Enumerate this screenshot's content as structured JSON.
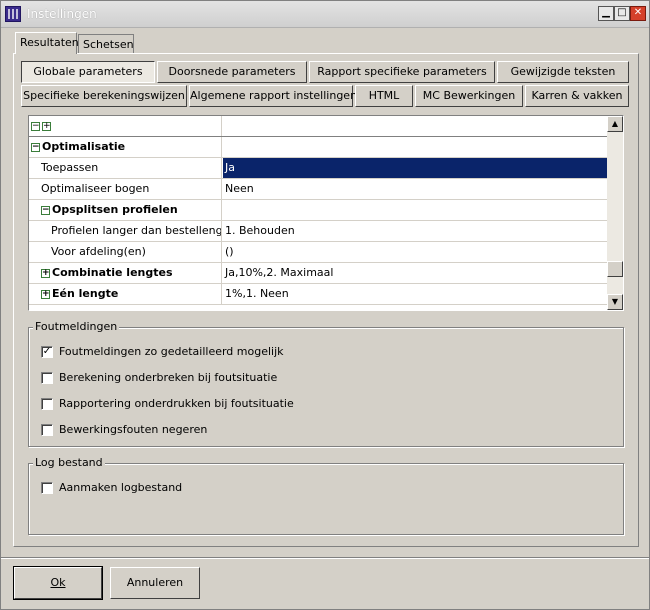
{
  "window": {
    "title": "Instellingen"
  },
  "tabs": [
    {
      "label": "Resultaten",
      "active": true
    },
    {
      "label": "Schetsen",
      "active": false
    }
  ],
  "param_buttons_row1": [
    {
      "label": "Globale parameters",
      "active": true
    },
    {
      "label": "Doorsnede parameters",
      "active": false
    },
    {
      "label": "Rapport specifieke parameters",
      "active": false
    },
    {
      "label": "Gewijzigde teksten",
      "active": false
    }
  ],
  "param_buttons_row2": [
    {
      "label": "Specifieke berekeningswijzen"
    },
    {
      "label": "Algemene rapport instellingen"
    },
    {
      "label": "HTML"
    },
    {
      "label": "MC Bewerkingen"
    },
    {
      "label": "Karren & vakken"
    }
  ],
  "grid": {
    "header": {
      "collapse": "−",
      "expand": "+"
    },
    "rows": [
      {
        "name": "Optimalisatie",
        "value": "",
        "bold": true,
        "expander": "−",
        "indent": 0
      },
      {
        "name": "Toepassen",
        "value": "Ja",
        "bold": false,
        "indent": 1,
        "selected": true
      },
      {
        "name": "Optimaliseer bogen",
        "value": "Neen",
        "bold": false,
        "indent": 1
      },
      {
        "name": "Opsplitsen profielen",
        "value": "",
        "bold": true,
        "expander": "−",
        "indent": 1
      },
      {
        "name": "Profielen langer dan bestellengte",
        "value": "1. Behouden",
        "bold": false,
        "indent": 2
      },
      {
        "name": "Voor afdeling(en)",
        "value": "()",
        "bold": false,
        "indent": 2
      },
      {
        "name": "Combinatie lengtes",
        "value": "Ja,10%,2. Maximaal",
        "bold": true,
        "expander": "+",
        "indent": 1
      },
      {
        "name": "Eén lengte",
        "value": "1%,1. Neen",
        "bold": true,
        "expander": "+",
        "indent": 1
      }
    ]
  },
  "foutmeldingen": {
    "title": "Foutmeldingen",
    "options": [
      {
        "label": "Foutmeldingen zo gedetailleerd mogelijk",
        "checked": true
      },
      {
        "label": "Berekening onderbreken bij foutsituatie",
        "checked": false
      },
      {
        "label": "Rapportering onderdrukken bij foutsituatie",
        "checked": false
      },
      {
        "label": "Bewerkingsfouten negeren",
        "checked": false
      }
    ]
  },
  "logbestand": {
    "title": "Log bestand",
    "options": [
      {
        "label": "Aanmaken logbestand",
        "checked": false
      }
    ]
  },
  "buttons": {
    "ok": "Ok",
    "cancel": "Annuleren"
  },
  "colors": {
    "selection": "#0a246a",
    "face": "#d4d0c8"
  }
}
